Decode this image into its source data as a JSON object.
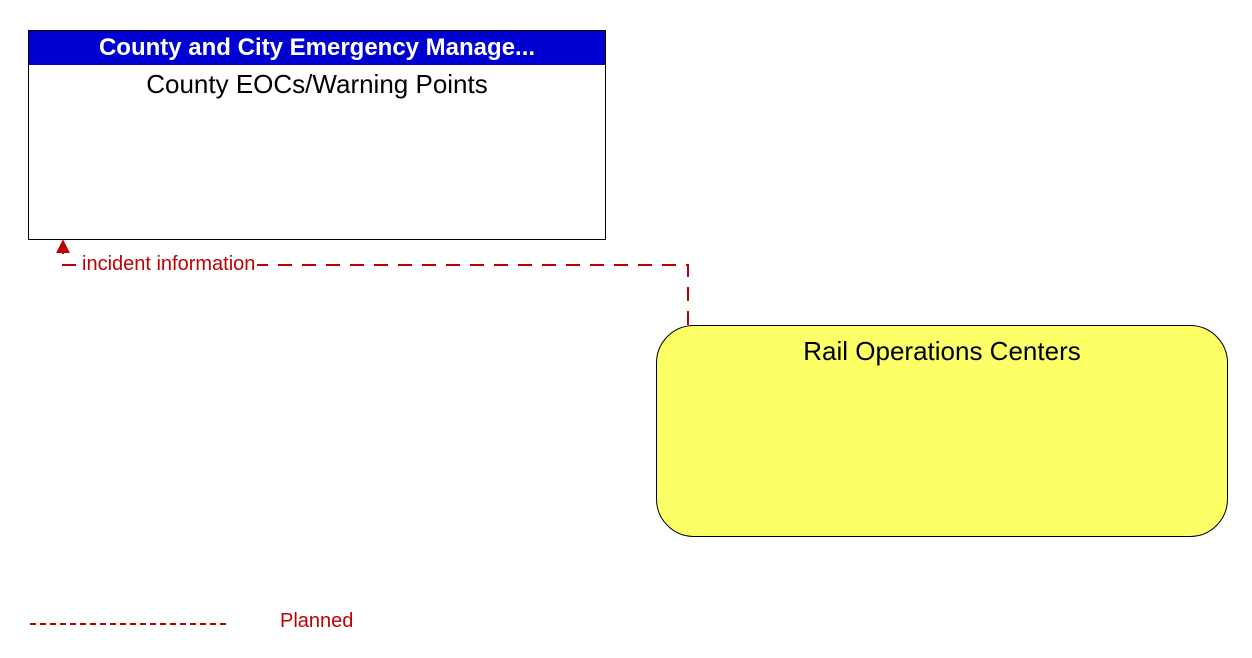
{
  "nodes": {
    "county": {
      "header": "County and City Emergency Manage...",
      "title": "County EOCs/Warning Points"
    },
    "rail": {
      "title": "Rail Operations Centers"
    }
  },
  "flows": {
    "incident": {
      "label": "incident information",
      "status": "planned"
    }
  },
  "legend": {
    "planned": "Planned"
  },
  "colors": {
    "planned_line": "#bd0000",
    "header_bg": "#0000d0",
    "rail_fill": "#fcff66"
  }
}
